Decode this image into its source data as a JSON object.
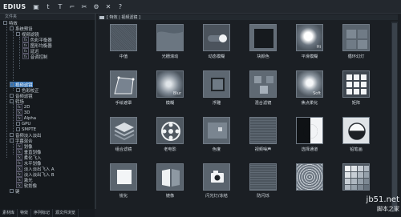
{
  "app": {
    "logo": "EDIUS"
  },
  "toolbar": {
    "icons": [
      "folder-icon",
      "tool-icon",
      "text-tool-icon",
      "split-icon",
      "cut-icon",
      "options-icon",
      "delete-icon",
      "help-icon"
    ]
  },
  "left_pane": {
    "title": "文件夹",
    "tree": [
      {
        "label": "特效"
      },
      {
        "label": "系统预设"
      },
      {
        "label": "视频滤镜"
      },
      {
        "label": "色彩平衡器"
      },
      {
        "label": "图形均衡器"
      },
      {
        "label": "延迟"
      },
      {
        "label": "音调控制"
      },
      {
        "label": "视频滤镜"
      },
      {
        "label": "色彩校正"
      },
      {
        "label": "音频滤镜"
      },
      {
        "label": "转场"
      },
      {
        "label": "2D"
      },
      {
        "label": "3D"
      },
      {
        "label": "Alpha"
      },
      {
        "label": "GPU"
      },
      {
        "label": "SMPTE"
      },
      {
        "label": "音频淡入淡出"
      },
      {
        "label": "字幕混合"
      },
      {
        "label": "划像"
      },
      {
        "label": "垂直划像"
      },
      {
        "label": "柔化飞入"
      },
      {
        "label": "水平划像"
      },
      {
        "label": "淡入淡出飞入 A"
      },
      {
        "label": "淡入淡出飞入 B"
      },
      {
        "label": "激光"
      },
      {
        "label": "软划像"
      },
      {
        "label": "键"
      }
    ]
  },
  "right_pane": {
    "path": "[ 特效 | 视频滤镜 ]",
    "effects": [
      {
        "label": "中值"
      },
      {
        "label": "光栅滚动"
      },
      {
        "label": "动态模糊"
      },
      {
        "label": "块颜色"
      },
      {
        "label": "平滑模糊"
      },
      {
        "label": "循环幻灯"
      },
      {
        "label": "手绘遮罩"
      },
      {
        "label": "模糊"
      },
      {
        "label": "浮雕"
      },
      {
        "label": "混合滤镜"
      },
      {
        "label": "焦点柔化"
      },
      {
        "label": "矩阵"
      },
      {
        "label": "组合滤镜"
      },
      {
        "label": "老电影"
      },
      {
        "label": "色度"
      },
      {
        "label": "视频噪声"
      },
      {
        "label": "选择通道"
      },
      {
        "label": "铅笔画"
      },
      {
        "label": "锐化"
      },
      {
        "label": "镜像"
      },
      {
        "label": "闪光灯/冻结"
      },
      {
        "label": "防闪烁"
      },
      {
        "label": ""
      },
      {
        "label": ""
      }
    ],
    "thumb_text": [
      "Hi",
      "Blur",
      "Soft"
    ]
  },
  "bottom_tabs": [
    "素材库",
    "特效",
    "序列标记",
    "源文件浏览"
  ],
  "watermark": {
    "line1": "jb51.net",
    "line2": "脚本之家"
  }
}
